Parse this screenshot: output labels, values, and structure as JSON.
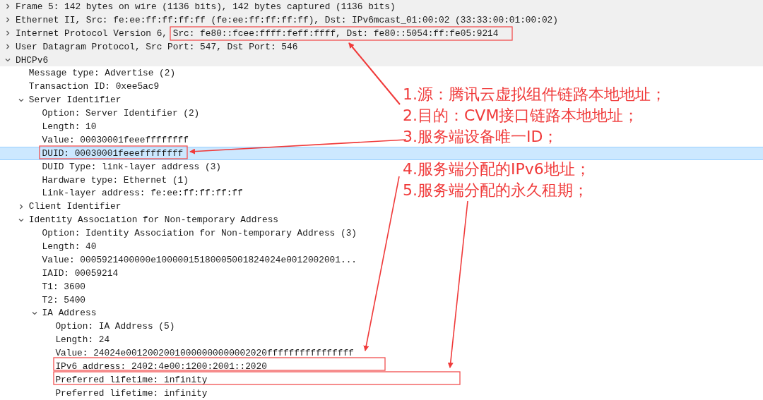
{
  "packet_details": [
    {
      "label": "Frame 5: 142 bytes on wire (1136 bits), 142 bytes captured (1136 bits)",
      "expanded": false,
      "selected": false
    },
    {
      "label": "Ethernet II, Src: fe:ee:ff:ff:ff:ff (fe:ee:ff:ff:ff:ff), Dst: IPv6mcast_01:00:02 (33:33:00:01:00:02)",
      "expanded": false,
      "selected": false
    },
    {
      "label": "Internet Protocol Version 6, Src: fe80::fcee:ffff:feff:ffff, Dst: fe80::5054:ff:fe05:9214",
      "expanded": false,
      "selected": false
    },
    {
      "label": "User Datagram Protocol, Src Port: 547, Dst Port: 546",
      "expanded": false,
      "selected": false
    },
    {
      "label": "DHCPv6",
      "expanded": true,
      "selected": false,
      "children": [
        {
          "label": "Message type: Advertise (2)",
          "selected": false
        },
        {
          "label": "Transaction ID: 0xee5ac9",
          "selected": false
        },
        {
          "label": "Server Identifier",
          "expanded": true,
          "selected": false,
          "children": [
            {
              "label": "Option: Server Identifier (2)",
              "selected": false
            },
            {
              "label": "Length: 10",
              "selected": false
            },
            {
              "label": "Value: 00030001feeeffffffff",
              "selected": false
            },
            {
              "label": "DUID: 00030001feeeffffffff",
              "selected": true
            },
            {
              "label": "DUID Type: link-layer address (3)",
              "selected": false
            },
            {
              "label": "Hardware type: Ethernet (1)",
              "selected": false
            },
            {
              "label": "Link-layer address: fe:ee:ff:ff:ff:ff",
              "selected": false
            }
          ]
        },
        {
          "label": "Client Identifier",
          "expanded": false,
          "selected": false
        },
        {
          "label": "Identity Association for Non-temporary Address",
          "expanded": true,
          "selected": false,
          "children": [
            {
              "label": "Option: Identity Association for Non-temporary Address (3)",
              "selected": false
            },
            {
              "label": "Length: 40",
              "selected": false
            },
            {
              "label": "Value: 0005921400000e10000015180005001824024e0012002001...",
              "selected": false
            },
            {
              "label": "IAID: 00059214",
              "selected": false
            },
            {
              "label": "T1: 3600",
              "selected": false
            },
            {
              "label": "T2: 5400",
              "selected": false
            },
            {
              "label": "IA Address",
              "expanded": true,
              "selected": false,
              "children": [
                {
                  "label": "Option: IA Address (5)",
                  "selected": false
                },
                {
                  "label": "Length: 24",
                  "selected": false
                },
                {
                  "label": "Value: 24024e00120020010000000000002020ffffffffffffffff",
                  "selected": false
                },
                {
                  "label": "IPv6 address: 2402:4e00:1200:2001::2020",
                  "selected": false
                },
                {
                  "label": "Preferred lifetime: infinity",
                  "selected": false
                },
                {
                  "label": "Preferred lifetime: infinity",
                  "selected": false
                }
              ]
            }
          ]
        }
      ]
    }
  ],
  "annotation_notes": [
    "1.源：腾讯云虚拟组件链路本地地址；",
    "2.目的：CVM接口链路本地地址；",
    "3.服务端设备唯一ID；",
    "4.服务端分配的IPv6地址；",
    "5.服务端分配的永久租期；"
  ]
}
